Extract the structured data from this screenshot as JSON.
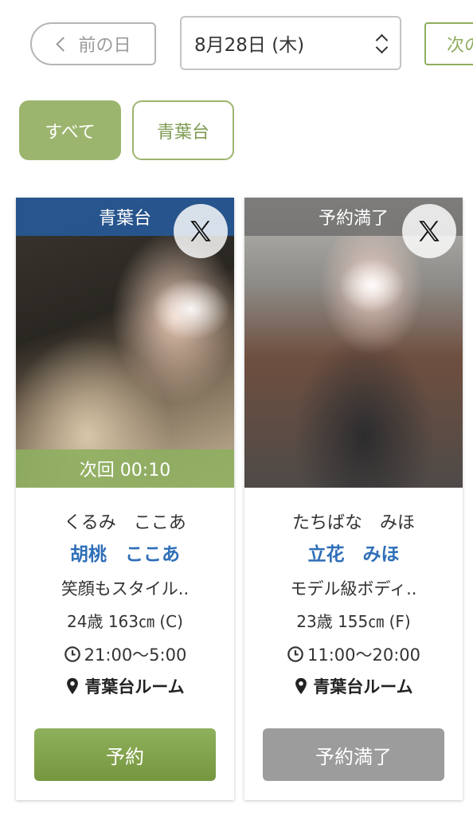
{
  "nav": {
    "prev_label": "前の日",
    "date_value": "8月28日 (木)",
    "next_label": "次の"
  },
  "filters": [
    {
      "label": "すべて",
      "active": true
    },
    {
      "label": "青葉台",
      "active": false
    }
  ],
  "cards": [
    {
      "banner": "青葉台",
      "next_time": "次回 00:10",
      "kana": "くるみ　ここあ",
      "name": "胡桃　ここあ",
      "catch": "笑顔もスタイル..",
      "spec": "24歳 163㎝ (C)",
      "hours": "21:00〜5:00",
      "room": "青葉台ルーム",
      "button": "予約"
    },
    {
      "banner": "予約満了",
      "kana": "たちばな　みほ",
      "name": "立花　みほ",
      "catch": "モデル級ボディ..",
      "spec": "23歳 155㎝ (F)",
      "hours": "11:00〜20:00",
      "room": "青葉台ルーム",
      "button": "予約満了"
    }
  ],
  "colors": {
    "accent_green": "#9cb56e",
    "name_blue": "#2f6fb8",
    "banner_blue": "#265896"
  },
  "icons": [
    "chevron-left-icon",
    "up-down-icon",
    "x-logo-icon",
    "clock-icon",
    "location-pin-icon"
  ]
}
